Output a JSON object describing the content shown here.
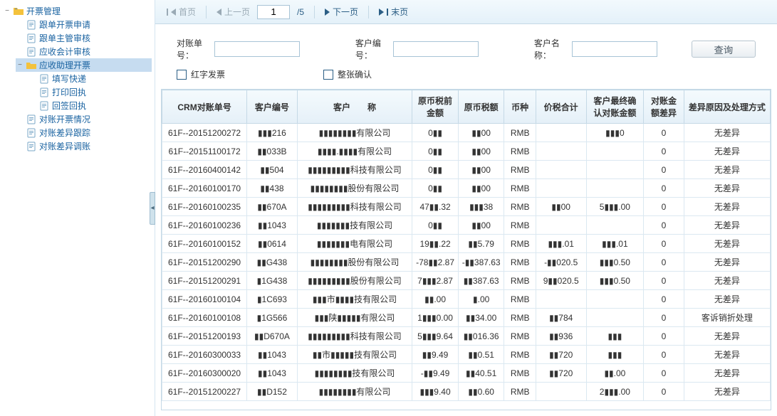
{
  "sidebar": {
    "root": "开票管理",
    "items": [
      {
        "label": "跟单开票申请",
        "type": "doc"
      },
      {
        "label": "跟单主管审核",
        "type": "doc"
      },
      {
        "label": "应收会计审核",
        "type": "doc"
      },
      {
        "label": "应收助理开票",
        "type": "folder",
        "selected": true,
        "children": [
          {
            "label": "填写快递",
            "type": "doc"
          },
          {
            "label": "打印回执",
            "type": "doc"
          },
          {
            "label": "回签回执",
            "type": "doc"
          }
        ]
      },
      {
        "label": "对账开票情况",
        "type": "doc"
      },
      {
        "label": "对账差异跟踪",
        "type": "doc"
      },
      {
        "label": "对账差异调账",
        "type": "doc"
      }
    ]
  },
  "toolbar": {
    "first": "首页",
    "prev": "上一页",
    "next": "下一页",
    "last": "末页",
    "page_value": "1",
    "total_pages": "/5"
  },
  "filters": {
    "l_order": "对账单号：",
    "l_cid": "客户编号：",
    "l_cname": "客户名称：",
    "btn_search": "查询",
    "cb_red": "红字发票",
    "cb_whole": "整张确认",
    "v_order": "",
    "v_cid": "",
    "v_cname": ""
  },
  "table": {
    "headers": {
      "crm": "CRM对账单号",
      "cid": "客户编号",
      "cname": "客户  称",
      "pretax": "原币税前金额",
      "tax": "原币税额",
      "cur": "币种",
      "total": "价税合计",
      "confirm": "客户最终确认对账金额",
      "diff": "对账金额差异",
      "reason": "差异原因及处理方式"
    },
    "rows": [
      {
        "crm": "61F--20151200272",
        "cid": "▮▮▮216",
        "cname": "▮▮▮▮▮▮▮▮有限公司",
        "pretax": "0▮▮",
        "tax": "▮▮00",
        "cur": "RMB",
        "total": "",
        "confirm": "▮▮▮0",
        "diff": "0",
        "reason": "无差异"
      },
      {
        "crm": "61F--20151100172",
        "cid": "▮▮033B",
        "cname": "▮▮▮▮.▮▮▮▮有限公司",
        "pretax": "0▮▮",
        "tax": "▮▮00",
        "cur": "RMB",
        "total": "",
        "confirm": "",
        "diff": "0",
        "reason": "无差异"
      },
      {
        "crm": "61F--20160400142",
        "cid": "▮▮504",
        "cname": "▮▮▮▮▮▮▮▮▮科技有限公司",
        "pretax": "0▮▮",
        "tax": "▮▮00",
        "cur": "RMB",
        "total": "",
        "confirm": "",
        "diff": "0",
        "reason": "无差异"
      },
      {
        "crm": "61F--20160100170",
        "cid": "▮▮438",
        "cname": "▮▮▮▮▮▮▮▮股份有限公司",
        "pretax": "0▮▮",
        "tax": "▮▮00",
        "cur": "RMB",
        "total": "",
        "confirm": "",
        "diff": "0",
        "reason": "无差异"
      },
      {
        "crm": "61F--20160100235",
        "cid": "▮▮670A",
        "cname": "▮▮▮▮▮▮▮▮▮科技有限公司",
        "pretax": "47▮▮.32",
        "tax": "▮▮▮38",
        "cur": "RMB",
        "total": "▮▮00",
        "confirm": "5▮▮▮.00",
        "diff": "0",
        "reason": "无差异"
      },
      {
        "crm": "61F--20160100236",
        "cid": "▮▮1043",
        "cname": "▮▮▮▮▮▮▮技有限公司",
        "pretax": "0▮▮",
        "tax": "▮▮00",
        "cur": "RMB",
        "total": "",
        "confirm": "",
        "diff": "0",
        "reason": "无差异"
      },
      {
        "crm": "61F--20160100152",
        "cid": "▮▮0614",
        "cname": "▮▮▮▮▮▮▮电有限公司",
        "pretax": "19▮▮.22",
        "tax": "▮▮5.79",
        "cur": "RMB",
        "total": "▮▮▮.01",
        "confirm": "▮▮▮.01",
        "diff": "0",
        "reason": "无差异"
      },
      {
        "crm": "61F--20151200290",
        "cid": "▮▮G438",
        "cname": "▮▮▮▮▮▮▮▮股份有限公司",
        "pretax": "-78▮▮2.87",
        "tax": "-▮▮387.63",
        "cur": "RMB",
        "total": "-▮▮020.5",
        "confirm": "▮▮▮0.50",
        "diff": "0",
        "reason": "无差异"
      },
      {
        "crm": "61F--20151200291",
        "cid": "▮1G438",
        "cname": "▮▮▮▮▮▮▮▮▮股份有限公司",
        "pretax": "7▮▮▮2.87",
        "tax": "▮▮387.63",
        "cur": "RMB",
        "total": "9▮▮020.5",
        "confirm": "▮▮▮0.50",
        "diff": "0",
        "reason": "无差异"
      },
      {
        "crm": "61F--20160100104",
        "cid": "▮1C693",
        "cname": "▮▮▮市▮▮▮▮技有限公司",
        "pretax": "▮▮.00",
        "tax": "▮.00",
        "cur": "RMB",
        "total": "",
        "confirm": "",
        "diff": "0",
        "reason": "无差异"
      },
      {
        "crm": "61F--20160100108",
        "cid": "▮1G566",
        "cname": "▮▮▮陕▮▮▮▮▮有限公司",
        "pretax": "1▮▮▮0.00",
        "tax": "▮▮34.00",
        "cur": "RMB",
        "total": "▮▮784",
        "confirm": "",
        "diff": "0",
        "reason": "客诉销折处理"
      },
      {
        "crm": "61F--20151200193",
        "cid": "▮▮D670A",
        "cname": "▮▮▮▮▮▮▮▮▮科技有限公司",
        "pretax": "5▮▮▮9.64",
        "tax": "▮▮016.36",
        "cur": "RMB",
        "total": "▮▮936",
        "confirm": "▮▮▮",
        "diff": "0",
        "reason": "无差异"
      },
      {
        "crm": "61F--20160300033",
        "cid": "▮▮1043",
        "cname": "▮▮市▮▮▮▮▮技有限公司",
        "pretax": "▮▮9.49",
        "tax": "▮▮0.51",
        "cur": "RMB",
        "total": "▮▮720",
        "confirm": "▮▮▮",
        "diff": "0",
        "reason": "无差异"
      },
      {
        "crm": "61F--20160300020",
        "cid": "▮▮1043",
        "cname": "▮▮▮▮▮▮▮▮技有限公司",
        "pretax": "-▮▮9.49",
        "tax": "▮▮40.51",
        "cur": "RMB",
        "total": "▮▮720",
        "confirm": "▮▮.00",
        "diff": "0",
        "reason": "无差异"
      },
      {
        "crm": "61F--20151200227",
        "cid": "▮▮D152",
        "cname": "▮▮▮▮▮▮▮▮有限公司",
        "pretax": "▮▮▮9.40",
        "tax": "▮▮0.60",
        "cur": "RMB",
        "total": "",
        "confirm": "2▮▮▮.00",
        "diff": "0",
        "reason": "无差异"
      }
    ]
  }
}
